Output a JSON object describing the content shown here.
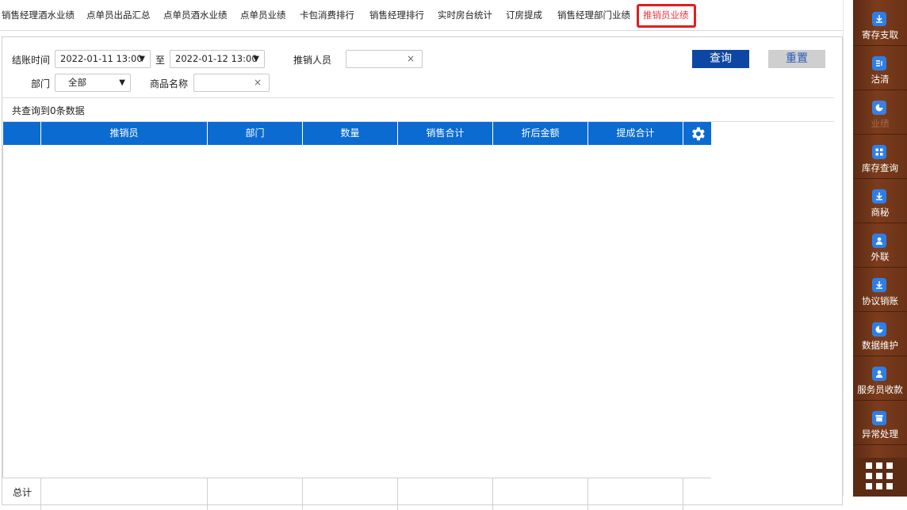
{
  "tabs": [
    {
      "label": "销售经理酒水业绩"
    },
    {
      "label": "点单员出品汇总"
    },
    {
      "label": "点单员酒水业绩"
    },
    {
      "label": "点单员业绩"
    },
    {
      "label": "卡包消费排行"
    },
    {
      "label": "销售经理排行"
    },
    {
      "label": "实时房台统计"
    },
    {
      "label": "订房提成"
    },
    {
      "label": "销售经理部门业绩"
    },
    {
      "label": "推销员业绩"
    }
  ],
  "active_tab": "推销员业绩",
  "filters": {
    "checkout_time_label": "结账时间",
    "start_time": "2022-01-11 13:00",
    "to_label": "至",
    "end_time": "2022-01-12 13:00",
    "salesperson_label": "推销人员",
    "salesperson_value": "",
    "department_label": "部门",
    "department_value": "全部",
    "product_name_label": "商品名称",
    "product_name_value": "",
    "clear_glyph": "×",
    "caret_glyph": "▼"
  },
  "buttons": {
    "query": "查询",
    "reset": "重置"
  },
  "result_count_text": "共查询到0条数据",
  "table": {
    "columns": [
      "推销员",
      "部门",
      "数量",
      "销售合计",
      "折后金额",
      "提成合计"
    ],
    "rows": [],
    "footer_label": "总计"
  },
  "sidebar": {
    "items": [
      {
        "label": "寄存支取",
        "icon": "download-icon"
      },
      {
        "label": "沽清",
        "icon": "list-icon"
      },
      {
        "label": "业绩",
        "icon": "pie-chart-icon"
      },
      {
        "label": "库存查询",
        "icon": "grid-icon"
      },
      {
        "label": "商秘",
        "icon": "download-icon"
      },
      {
        "label": "外联",
        "icon": "user-icon"
      },
      {
        "label": "协议销账",
        "icon": "download-icon"
      },
      {
        "label": "数据维护",
        "icon": "pie-chart-icon"
      },
      {
        "label": "服务员收款",
        "icon": "user-icon"
      },
      {
        "label": "异常处理",
        "icon": "box-icon"
      }
    ],
    "more_icon": "apps-grid-icon"
  },
  "colors": {
    "header_blue": "#0b6bd1",
    "query_button": "#0e46a4",
    "active_tab_red": "#e8373a",
    "sidebar_brown": "#6a3217"
  }
}
